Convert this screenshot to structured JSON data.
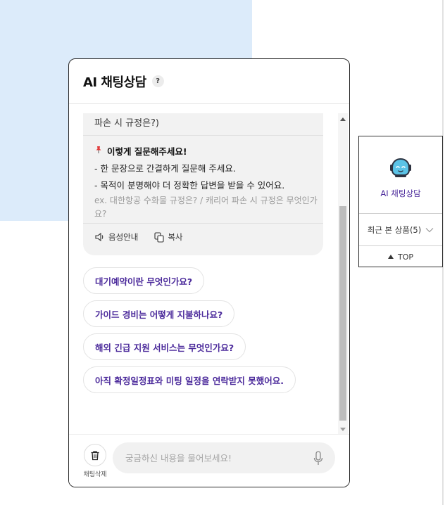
{
  "header": {
    "title": "AI 채팅상담",
    "help_icon": "?"
  },
  "answer_card": {
    "tail_text": "파손 시 규정은?)",
    "tips_title": "이렇게 질문해주세요!",
    "tips": [
      "- 한 문장으로 간결하게 질문해 주세요.",
      "- 목적이 분명해야 더 정확한 답변을 받을 수 있어요."
    ],
    "example": "ex. 대한항공 수화물 규정은? / 캐리어 파손 시 규정은 무엇인가요?",
    "actions": {
      "voice_label": "음성안내",
      "copy_label": "복사"
    }
  },
  "suggestions": [
    "대기예약이란 무엇인가요?",
    "가이드 경비는 어떻게 지불하나요?",
    "해외 긴급 지원 서비스는 무엇인가요?",
    "아직 확정일정표와 미팅 일정을 연락받지 못했어요."
  ],
  "footer": {
    "delete_label": "채팅삭제",
    "input_placeholder": "궁금하신 내용을 물어보세요!",
    "input_value": ""
  },
  "side_widget": {
    "ai_label": "AI 채팅상담",
    "recent_label": "최근 본 상품(5)",
    "top_label": "TOP"
  },
  "colors": {
    "accent": "#4b2a9b",
    "robot": "#5bc3e6",
    "background_block": "#dcebfa"
  }
}
